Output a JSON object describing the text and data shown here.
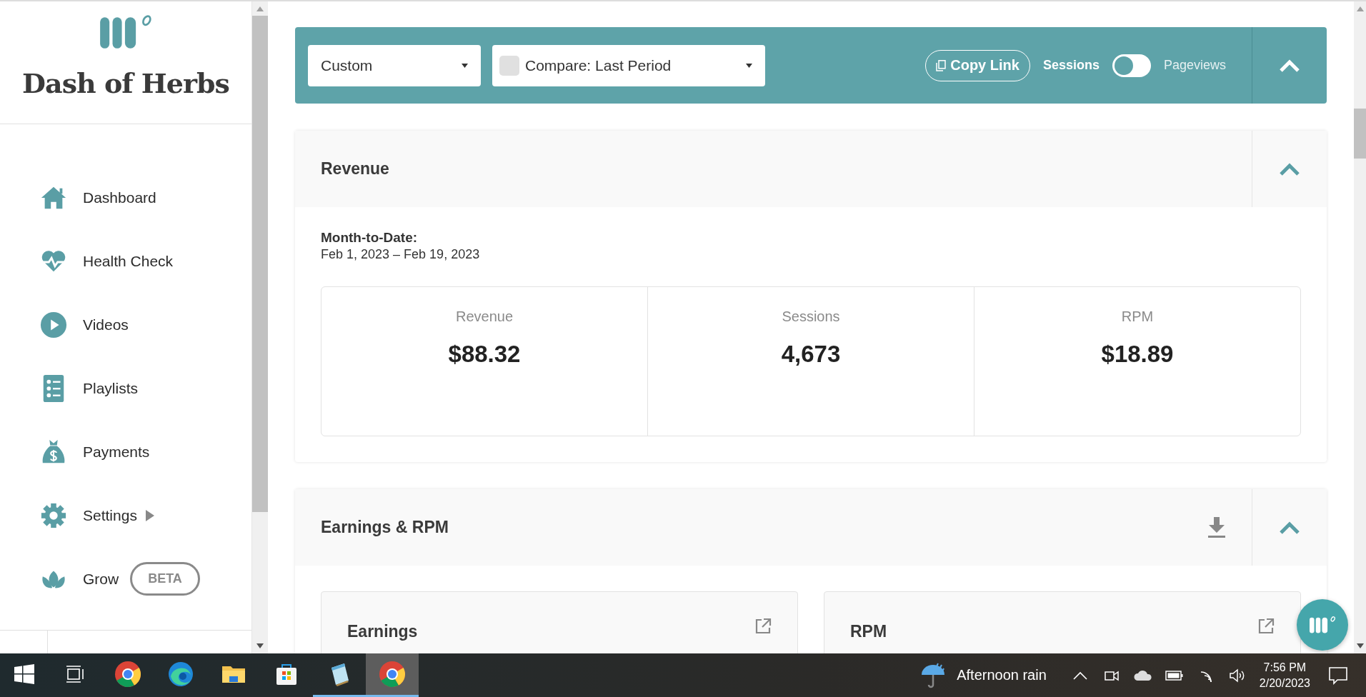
{
  "sidebar": {
    "brand": "Dash of Herbs",
    "items": [
      {
        "label": "Dashboard",
        "kind": "home",
        "expandable": false
      },
      {
        "label": "Health Check",
        "kind": "heart",
        "expandable": false
      },
      {
        "label": "Videos",
        "kind": "play",
        "expandable": false
      },
      {
        "label": "Playlists",
        "kind": "list",
        "expandable": false
      },
      {
        "label": "Payments",
        "kind": "moneybag",
        "expandable": false
      },
      {
        "label": "Settings",
        "kind": "gear",
        "expandable": true
      },
      {
        "label": "Grow",
        "kind": "leaf",
        "expandable": false,
        "badge": "BETA"
      }
    ]
  },
  "toolbar": {
    "period": {
      "value": "Custom"
    },
    "compare": {
      "label": "Compare: Last Period",
      "checked": false
    },
    "copy_link": "Copy Link",
    "metric_toggle": [
      {
        "label": "Sessions",
        "selected": true
      },
      {
        "label": "Pageviews",
        "selected": false
      }
    ],
    "expanded": true
  },
  "revenue_panel": {
    "title": "Revenue",
    "expanded": true,
    "period_label": "Month-to-Date:",
    "period_range": "Feb 1, 2023 – Feb 19, 2023",
    "stats": [
      {
        "label": "Revenue",
        "value": "$88.32"
      },
      {
        "label": "Sessions",
        "value": "4,673"
      },
      {
        "label": "RPM",
        "value": "$18.89"
      }
    ]
  },
  "earnings_panel": {
    "title": "Earnings & RPM",
    "expanded": true,
    "cards": [
      {
        "title": "Earnings"
      },
      {
        "title": "RPM"
      }
    ]
  },
  "taskbar": {
    "apps": [
      {
        "kind": "chrome",
        "running": false,
        "active": false
      },
      {
        "kind": "edge",
        "running": false,
        "active": false
      },
      {
        "kind": "folder",
        "running": false,
        "active": false
      },
      {
        "kind": "store",
        "running": false,
        "active": false
      },
      {
        "kind": "notepad",
        "running": true,
        "active": false
      },
      {
        "kind": "chrome",
        "running": true,
        "active": true
      }
    ],
    "weather": "Afternoon rain",
    "time": "7:56 PM",
    "date": "2/20/2023"
  }
}
